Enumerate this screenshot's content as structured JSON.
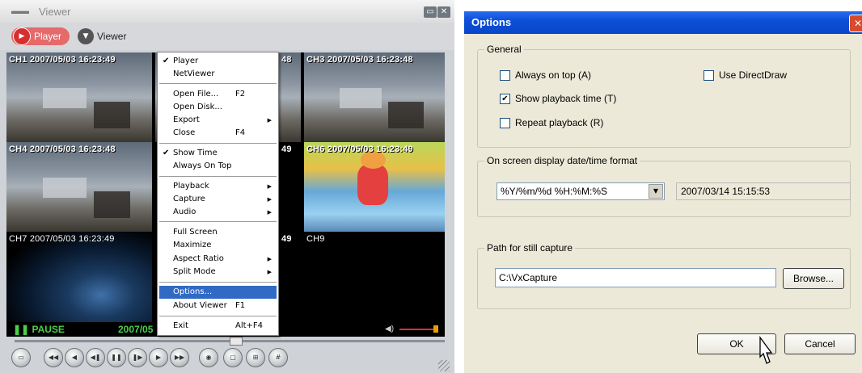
{
  "viewer": {
    "title": "Viewer",
    "app_icon": "viewer-app-icon",
    "minimize_icon": "minimize-icon",
    "close_icon": "close-icon",
    "modes": {
      "player": "Player",
      "viewer": "Viewer"
    },
    "channels": [
      {
        "label": "CH1 2007/05/03 16:23:49",
        "scene": "office"
      },
      {
        "label": "48",
        "scene": "office"
      },
      {
        "label": "CH3 2007/05/03 16:23:48",
        "scene": "office"
      },
      {
        "label": "CH4 2007/05/03 16:23:48",
        "scene": "office"
      },
      {
        "label": "49",
        "scene": "dark"
      },
      {
        "label": "CH6 2007/05/03 16:23:49",
        "scene": "cartoon"
      },
      {
        "label": "CH7 2007/05/03 16:23:49",
        "scene": "ocean"
      },
      {
        "label": "49",
        "scene": "dark"
      },
      {
        "label": "CH9",
        "scene": "dark"
      }
    ],
    "status": {
      "state": "PAUSE",
      "date": "2007/05",
      "volume_icon": "speaker-icon"
    }
  },
  "menu": {
    "items": [
      {
        "label": "Player",
        "checked": true
      },
      {
        "label": "NetViewer"
      },
      {
        "label": "Open File...",
        "shortcut": "F2"
      },
      {
        "label": "Open Disk..."
      },
      {
        "label": "Export",
        "submenu": true
      },
      {
        "label": "Close",
        "shortcut": "F4"
      },
      {
        "label": "Show Time",
        "checked": true
      },
      {
        "label": "Always On Top"
      },
      {
        "label": "Playback",
        "submenu": true
      },
      {
        "label": "Capture",
        "submenu": true
      },
      {
        "label": "Audio",
        "submenu": true
      },
      {
        "label": "Full Screen"
      },
      {
        "label": "Maximize"
      },
      {
        "label": "Aspect Ratio",
        "submenu": true
      },
      {
        "label": "Split Mode",
        "submenu": true
      },
      {
        "label": "Options...",
        "highlighted": true
      },
      {
        "label": "About Viewer",
        "shortcut": "F1"
      },
      {
        "label": "Exit",
        "shortcut": "Alt+F4"
      }
    ]
  },
  "options": {
    "title": "Options",
    "general": {
      "title": "General",
      "always_on_top": {
        "label": "Always on top (A)",
        "checked": false
      },
      "use_directdraw": {
        "label": "Use DirectDraw",
        "checked": false
      },
      "show_playback_time": {
        "label": "Show playback time (T)",
        "checked": true
      },
      "repeat_playback": {
        "label": "Repeat playback (R)",
        "checked": false
      }
    },
    "osd": {
      "title": "On screen display date/time format",
      "format_value": "%Y/%m/%d %H:%M:%S",
      "preview": "2007/03/14 15:15:53"
    },
    "capture": {
      "title": "Path for still capture",
      "path": "C:\\VxCapture",
      "browse": "Browse..."
    },
    "ok": "OK",
    "cancel": "Cancel"
  },
  "colors": {
    "menu_highlight": "#316ac5",
    "xp_title_blue": "#0c4fd8",
    "status_green": "#4ad04a",
    "player_red": "#d53030"
  }
}
